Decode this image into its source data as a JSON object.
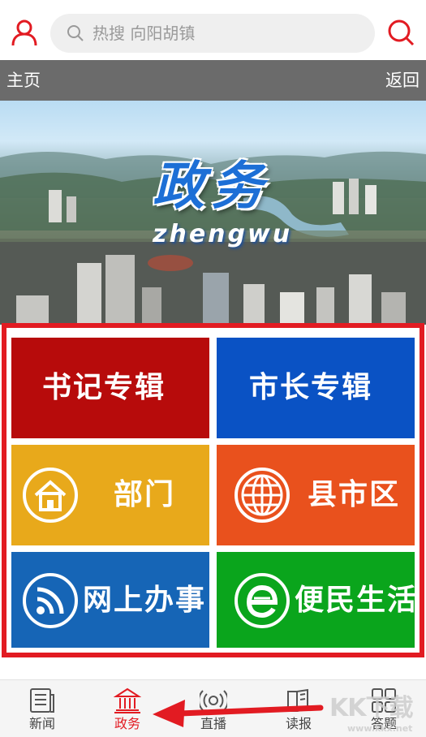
{
  "search": {
    "placeholder": "热搜 向阳胡镇"
  },
  "navbar": {
    "home_label": "主页",
    "back_label": "返回"
  },
  "banner": {
    "title": "政务",
    "subtitle": "zhengwu"
  },
  "tiles": [
    {
      "label": "书记专辑",
      "color": "#b70b0b"
    },
    {
      "label": "市长专辑",
      "color": "#0a52c4"
    },
    {
      "label": "部门",
      "color": "#e8a91b",
      "icon": "home-icon"
    },
    {
      "label": "县市区",
      "color": "#e9511d",
      "icon": "globe-icon"
    },
    {
      "label": "网上办事",
      "color": "#1665b6",
      "icon": "rss-icon"
    },
    {
      "label": "便民生活",
      "color": "#0aa51c",
      "icon": "ie-icon"
    }
  ],
  "tabs": [
    {
      "label": "新闻",
      "icon": "newspaper-icon"
    },
    {
      "label": "政务",
      "icon": "government-building-icon",
      "active": true
    },
    {
      "label": "直播",
      "icon": "broadcast-icon"
    },
    {
      "label": "读报",
      "icon": "book-icon"
    },
    {
      "label": "答题",
      "icon": "grid-icon"
    }
  ],
  "watermark": {
    "main": "KK下载",
    "url": "www.kkx.net"
  },
  "colors": {
    "accent": "#e21b22",
    "navbar": "#6b6b6b"
  }
}
